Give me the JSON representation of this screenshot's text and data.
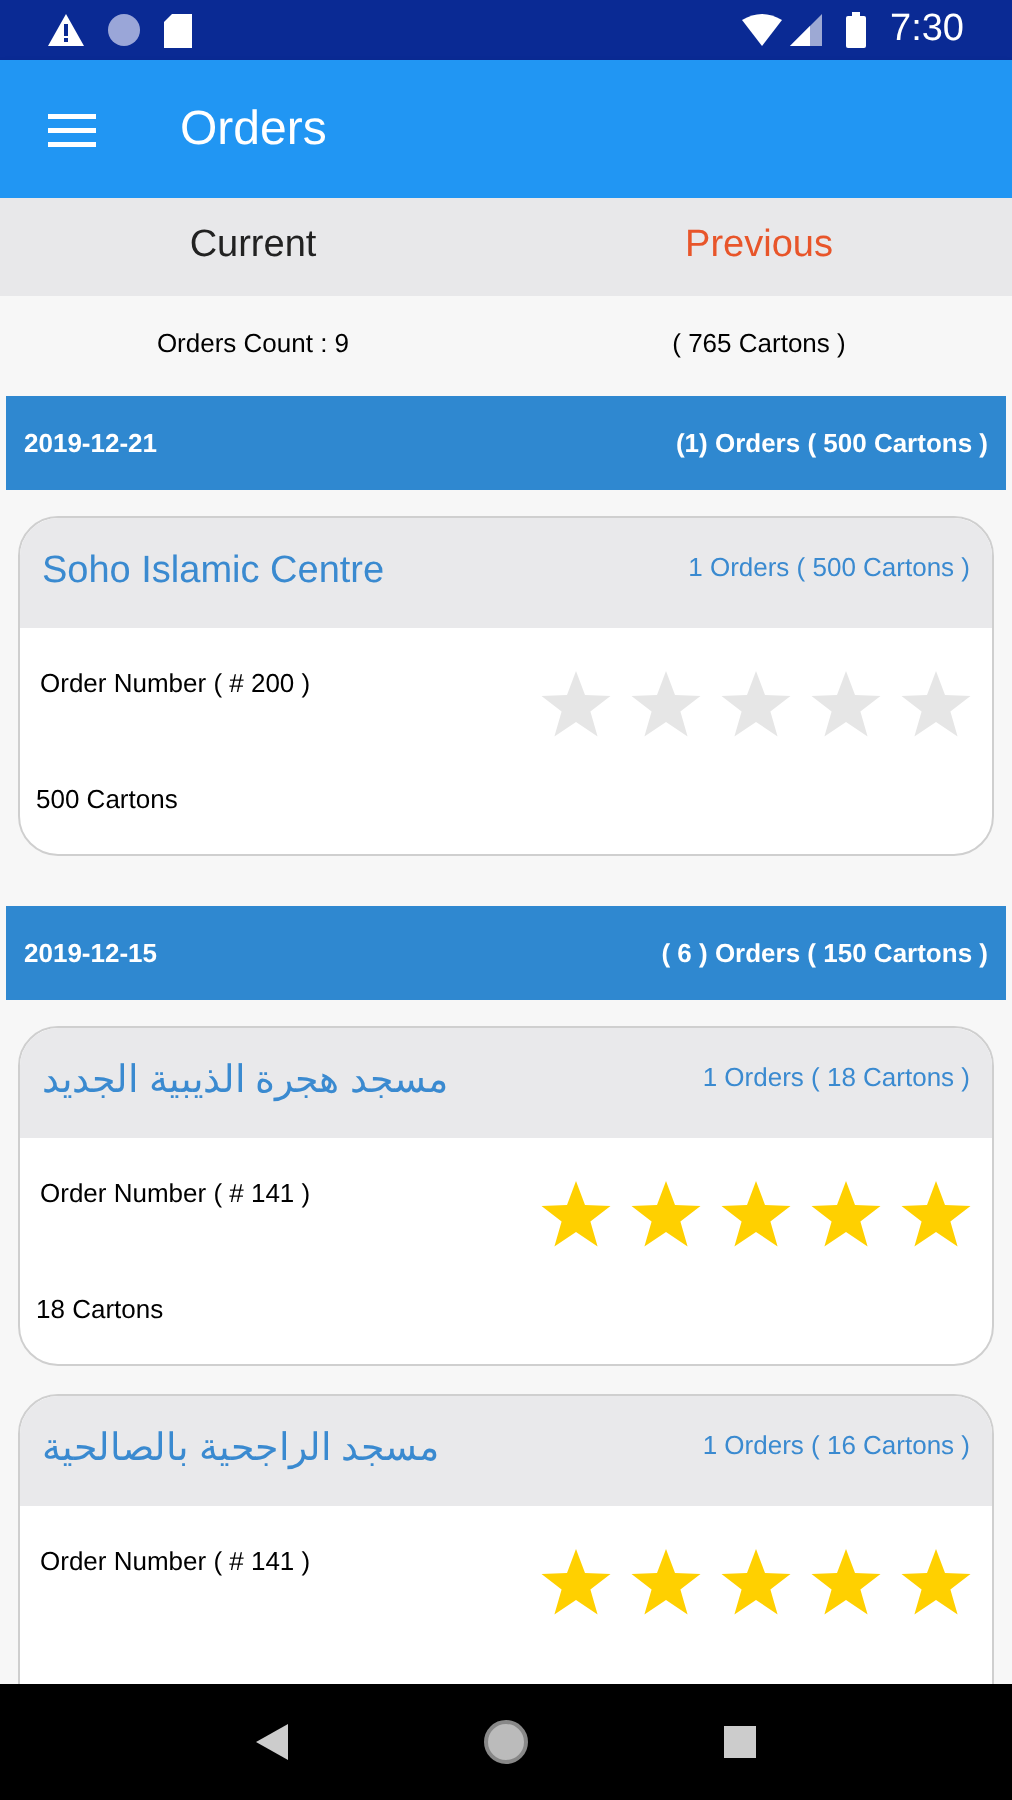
{
  "status_bar": {
    "time": "7:30"
  },
  "app_bar": {
    "title": "Orders"
  },
  "tabs": [
    {
      "label": "Current",
      "selected": false
    },
    {
      "label": "Previous",
      "selected": true
    }
  ],
  "summary": {
    "count": "Orders Count : 9",
    "cartons": "( 765 Cartons )"
  },
  "groups": [
    {
      "date": "2019-12-21",
      "total": "(1) Orders ( 500 Cartons )",
      "orders": [
        {
          "name": "Soho Islamic Centre",
          "count": "1 Orders ( 500 Cartons )",
          "number": "Order Number ( # 200 )",
          "stars": 0,
          "cartons": "500 Cartons"
        }
      ]
    },
    {
      "date": "2019-12-15",
      "total": "( 6 ) Orders ( 150 Cartons )",
      "orders": [
        {
          "name": "مسجد هجرة الذيبية الجديد",
          "count": "1 Orders ( 18 Cartons )",
          "number": "Order Number ( # 141 )",
          "stars": 5,
          "cartons": "18 Cartons"
        },
        {
          "name": "مسجد الراجحية بالصالحية",
          "count": "1 Orders ( 16 Cartons )",
          "number": "Order Number ( # 141 )",
          "stars": 5
        }
      ]
    }
  ]
}
